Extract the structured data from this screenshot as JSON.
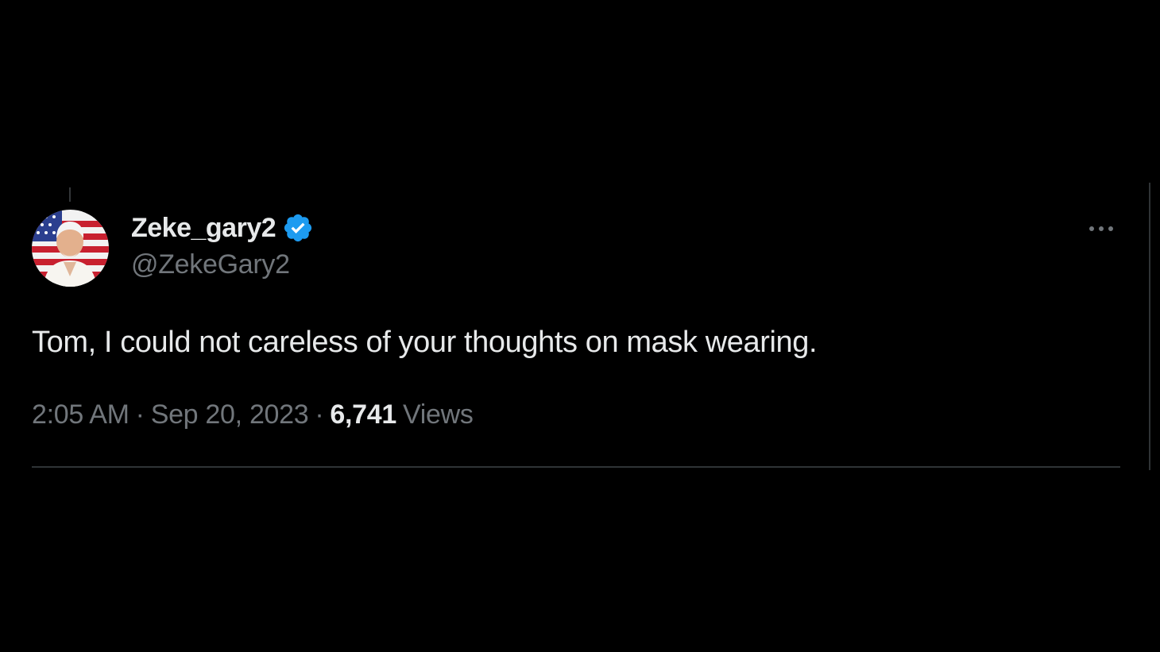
{
  "tweet": {
    "author": {
      "display_name": "Zeke_gary2",
      "handle": "@ZekeGary2",
      "verified": true,
      "avatar_icon": "user-avatar-flag-background"
    },
    "text": "Tom, I could not careless of your thoughts on mask wearing.",
    "time": "2:05 AM",
    "separator": "·",
    "date": "Sep 20, 2023",
    "views_count": "6,741",
    "views_label": "Views",
    "more_icon": "more-horizontal-icon"
  },
  "colors": {
    "background": "#000000",
    "primary_text": "#e7e9ea",
    "secondary_text": "#71767b",
    "verified_blue": "#1d9bf0",
    "divider": "#2f3336"
  }
}
